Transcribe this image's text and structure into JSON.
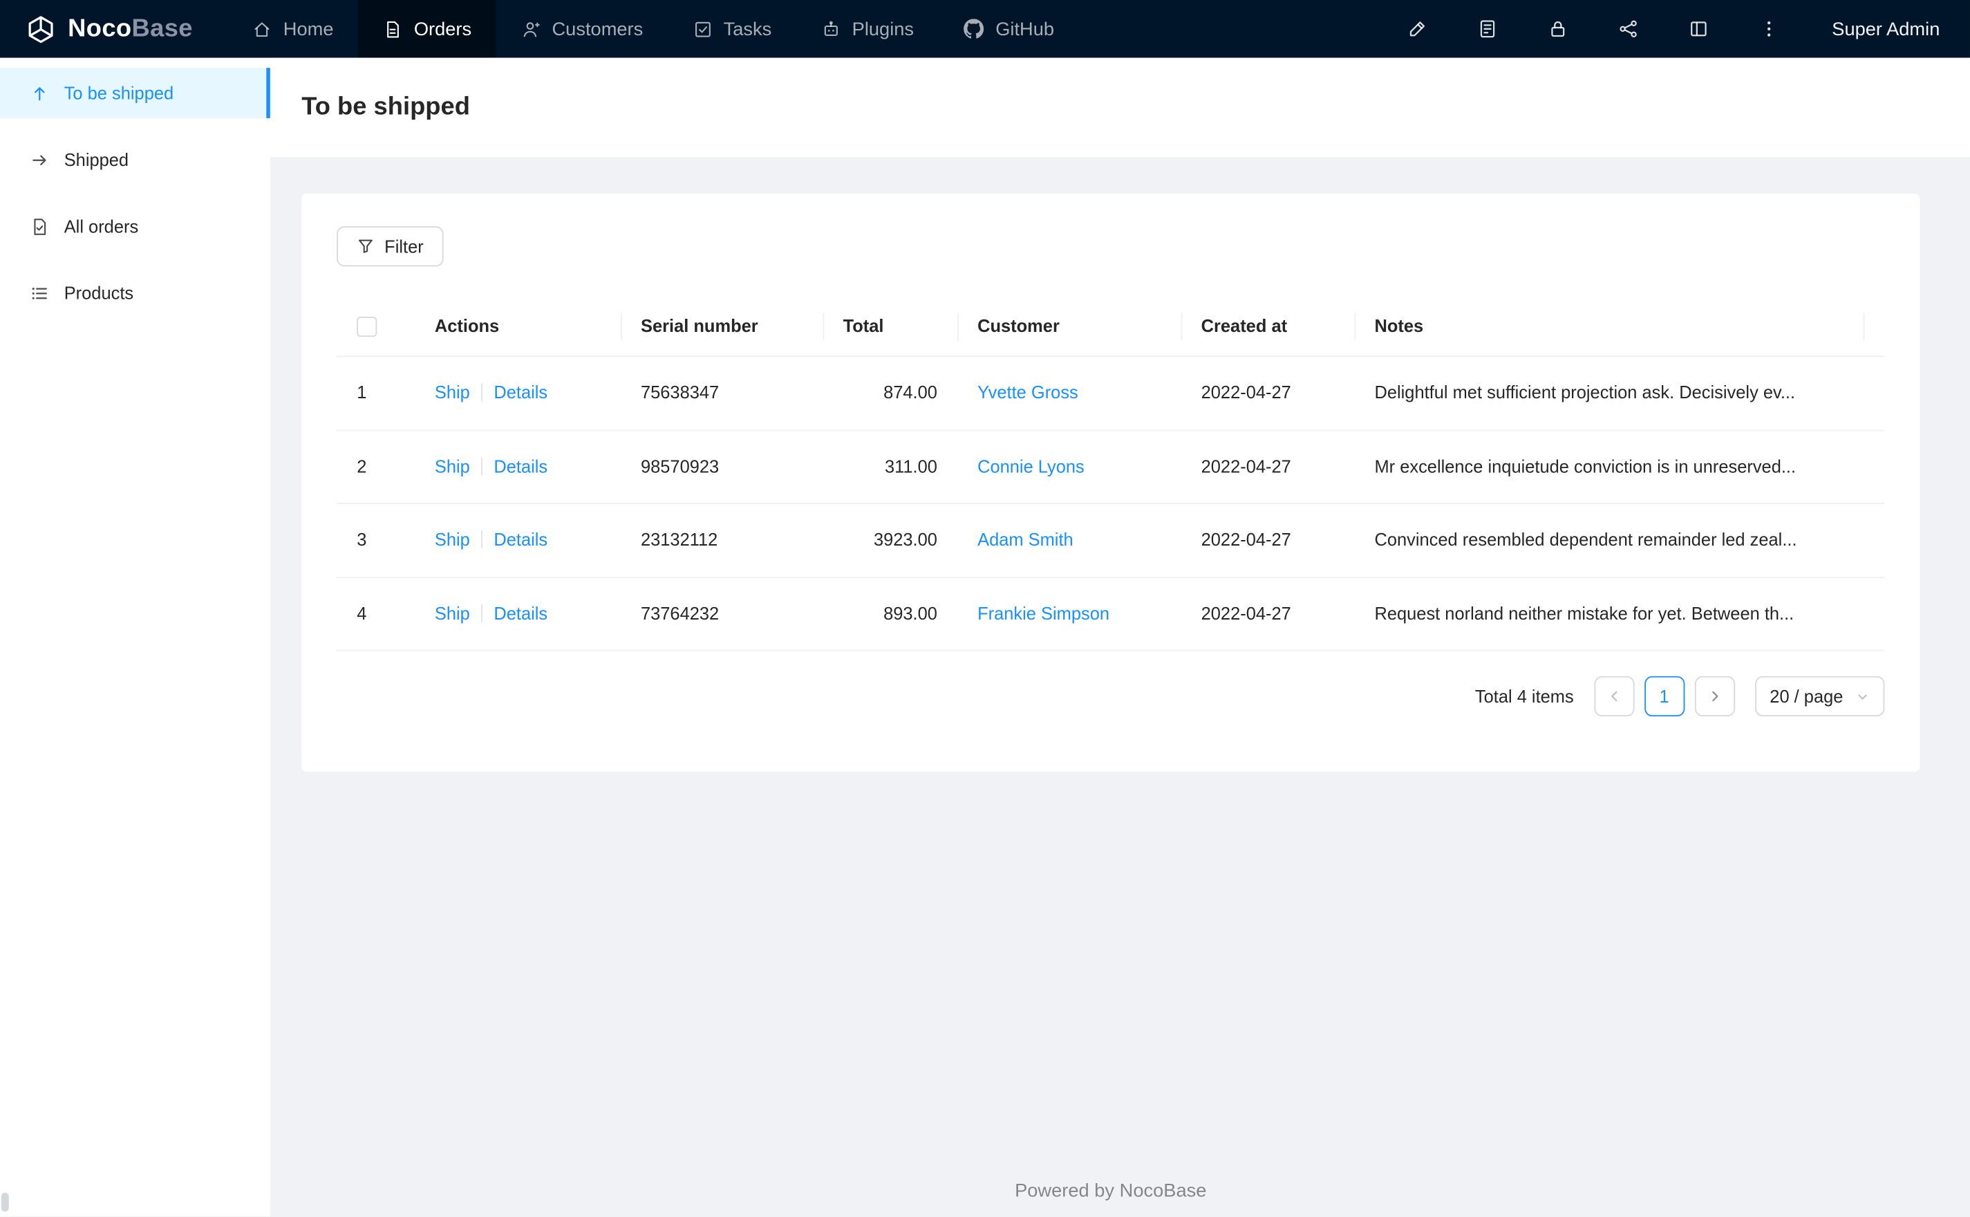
{
  "colors": {
    "accent": "#1890ff",
    "topbar_bg": "#001529",
    "topbar_active_bg": "#000c17",
    "sidebar_active_bg": "#e6f7ff",
    "page_bg": "#f0f2f5",
    "table_border": "#f0f0f0"
  },
  "topbar": {
    "logo": {
      "part1": "Noco",
      "part2": "Base",
      "icon": "nocobase-logo-icon"
    },
    "nav": [
      {
        "label": "Home",
        "icon": "home-icon",
        "active": false
      },
      {
        "label": "Orders",
        "icon": "orders-icon",
        "active": true
      },
      {
        "label": "Customers",
        "icon": "customers-icon",
        "active": false
      },
      {
        "label": "Tasks",
        "icon": "tasks-icon",
        "active": false
      },
      {
        "label": "Plugins",
        "icon": "plugins-icon",
        "active": false
      },
      {
        "label": "GitHub",
        "icon": "github-icon",
        "active": false
      }
    ],
    "tools": [
      "highlighter-icon",
      "calculator-icon",
      "lock-icon",
      "share-nodes-icon",
      "layout-icon",
      "more-icon"
    ],
    "user": "Super Admin"
  },
  "sidebar": {
    "items": [
      {
        "label": "To be shipped",
        "icon": "arrow-up-icon",
        "active": true
      },
      {
        "label": "Shipped",
        "icon": "arrow-right-icon",
        "active": false
      },
      {
        "label": "All orders",
        "icon": "order-file-icon",
        "active": false
      },
      {
        "label": "Products",
        "icon": "list-icon",
        "active": false
      }
    ]
  },
  "page": {
    "title": "To be shipped"
  },
  "toolbar": {
    "filter_label": "Filter",
    "filter_icon": "filter-funnel-icon"
  },
  "table": {
    "columns": [
      "Actions",
      "Serial number",
      "Total",
      "Customer",
      "Created at",
      "Notes"
    ],
    "rows": [
      {
        "index": "1",
        "actions": [
          "Ship",
          "Details"
        ],
        "serial": "75638347",
        "total": "874.00",
        "customer": "Yvette Gross",
        "created": "2022-04-27",
        "notes": "Delightful met sufficient projection ask. Decisively ev..."
      },
      {
        "index": "2",
        "actions": [
          "Ship",
          "Details"
        ],
        "serial": "98570923",
        "total": "311.00",
        "customer": "Connie Lyons",
        "created": "2022-04-27",
        "notes": "Mr excellence inquietude conviction is in unreserved..."
      },
      {
        "index": "3",
        "actions": [
          "Ship",
          "Details"
        ],
        "serial": "23132112",
        "total": "3923.00",
        "customer": "Adam Smith",
        "created": "2022-04-27",
        "notes": "Convinced resembled dependent remainder led zeal..."
      },
      {
        "index": "4",
        "actions": [
          "Ship",
          "Details"
        ],
        "serial": "73764232",
        "total": "893.00",
        "customer": "Frankie Simpson",
        "created": "2022-04-27",
        "notes": "Request norland neither mistake for yet. Between th..."
      }
    ]
  },
  "pagination": {
    "total_label": "Total 4 items",
    "current_page": "1",
    "page_size": "20 / page"
  },
  "footer": {
    "text": "Powered by NocoBase"
  }
}
